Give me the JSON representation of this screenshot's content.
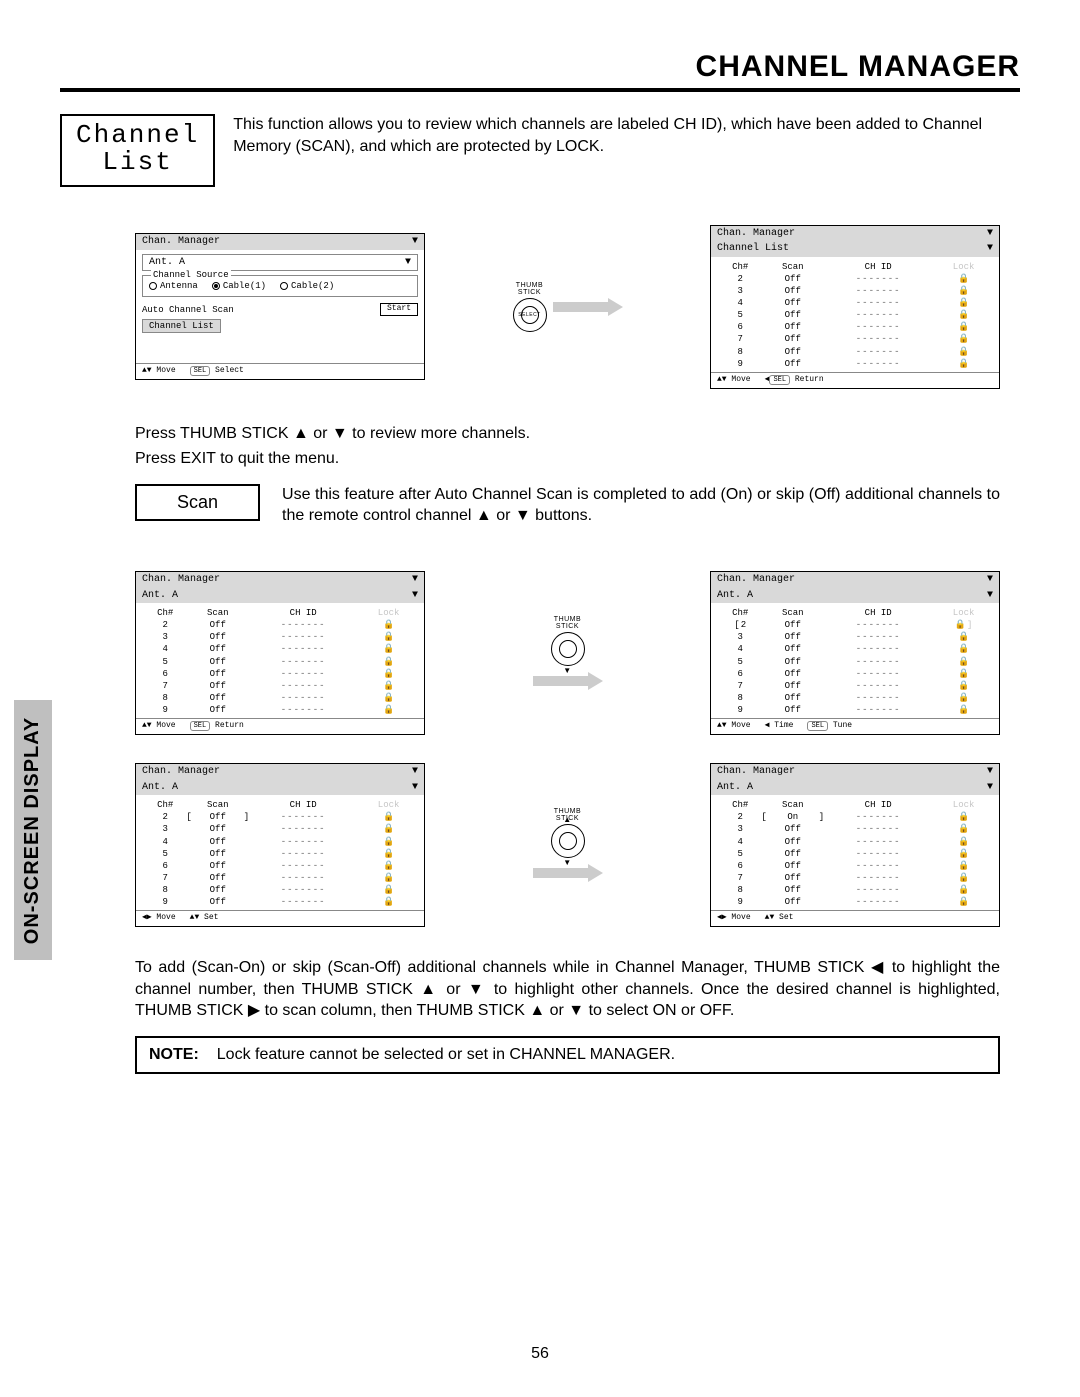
{
  "header": {
    "title": "CHANNEL MANAGER"
  },
  "boxTitle": {
    "line1": "Channel",
    "line2": "List"
  },
  "intro": "This function allows you to review which channels are labeled CH ID), which have been added to Channel Memory (SCAN), and which are protected by LOCK.",
  "sidebar": {
    "label": "ON-SCREEN DISPLAY"
  },
  "thumb": {
    "label1": "THUMB",
    "label2": "STICK",
    "select": "SELECT"
  },
  "panelA": {
    "bar": "Chan. Manager",
    "ant": "Ant. A",
    "sourceLegend": "Channel Source",
    "r1": "Antenna",
    "r2": "Cable(1)",
    "r3": "Cable(2)",
    "autoScan": "Auto Channel Scan",
    "start": "Start",
    "chList": "Channel List",
    "footMove": "Move",
    "footSel": "Select",
    "sel": "SEL",
    "ud": "▲▼"
  },
  "panelB": {
    "bar": "Chan. Manager",
    "sub": "Channel List",
    "headers": {
      "ch": "Ch#",
      "scan": "Scan",
      "chid": "CH ID",
      "lock": "Lock"
    },
    "rows": [
      {
        "ch": "2",
        "scan": "Off",
        "chid": "-------",
        "lock": "🔒"
      },
      {
        "ch": "3",
        "scan": "Off",
        "chid": "-------",
        "lock": "🔒"
      },
      {
        "ch": "4",
        "scan": "Off",
        "chid": "-------",
        "lock": "🔒"
      },
      {
        "ch": "5",
        "scan": "Off",
        "chid": "-------",
        "lock": "🔒"
      },
      {
        "ch": "6",
        "scan": "Off",
        "chid": "-------",
        "lock": "🔒"
      },
      {
        "ch": "7",
        "scan": "Off",
        "chid": "-------",
        "lock": "🔒"
      },
      {
        "ch": "8",
        "scan": "Off",
        "chid": "-------",
        "lock": "🔒"
      },
      {
        "ch": "9",
        "scan": "Off",
        "chid": "-------",
        "lock": "🔒"
      }
    ],
    "footMove": "Move",
    "footRet": "Return",
    "ud": "▲▼",
    "lt": "◀",
    "sel": "SEL"
  },
  "review": {
    "line1": "Press THUMB STICK ▲ or ▼ to review more channels.",
    "line2": "Press EXIT to quit the menu."
  },
  "scanBox": "Scan",
  "scanPara": "Use this feature after Auto Channel Scan is completed to add (On) or skip (Off) additional channels to the remote control channel ▲ or ▼ buttons.",
  "panelC": {
    "bar": "Chan. Manager",
    "ant": "Ant. A",
    "headers": {
      "ch": "Ch#",
      "scan": "Scan",
      "chid": "CH ID",
      "lock": "Lock"
    },
    "rows": [
      {
        "ch": "2",
        "scan": "Off",
        "chid": "-------",
        "lock": "🔒"
      },
      {
        "ch": "3",
        "scan": "Off",
        "chid": "-------",
        "lock": "🔒"
      },
      {
        "ch": "4",
        "scan": "Off",
        "chid": "-------",
        "lock": "🔒"
      },
      {
        "ch": "5",
        "scan": "Off",
        "chid": "-------",
        "lock": "🔒"
      },
      {
        "ch": "6",
        "scan": "Off",
        "chid": "-------",
        "lock": "🔒"
      },
      {
        "ch": "7",
        "scan": "Off",
        "chid": "-------",
        "lock": "🔒"
      },
      {
        "ch": "8",
        "scan": "Off",
        "chid": "-------",
        "lock": "🔒"
      },
      {
        "ch": "9",
        "scan": "Off",
        "chid": "-------",
        "lock": "🔒"
      }
    ],
    "footMove": "Move",
    "footRet": "Return",
    "ud": "▲▼",
    "sel": "SEL"
  },
  "panelD": {
    "bar": "Chan. Manager",
    "ant": "Ant. A",
    "headers": {
      "ch": "Ch#",
      "scan": "Scan",
      "chid": "CH ID",
      "lock": "Lock"
    },
    "rows": [
      {
        "ch": "2",
        "scan": "Off",
        "chid": "-------",
        "lock": "🔒",
        "sel": true
      },
      {
        "ch": "3",
        "scan": "Off",
        "chid": "-------",
        "lock": "🔒"
      },
      {
        "ch": "4",
        "scan": "Off",
        "chid": "-------",
        "lock": "🔒"
      },
      {
        "ch": "5",
        "scan": "Off",
        "chid": "-------",
        "lock": "🔒"
      },
      {
        "ch": "6",
        "scan": "Off",
        "chid": "-------",
        "lock": "🔒"
      },
      {
        "ch": "7",
        "scan": "Off",
        "chid": "-------",
        "lock": "🔒"
      },
      {
        "ch": "8",
        "scan": "Off",
        "chid": "-------",
        "lock": "🔒"
      },
      {
        "ch": "9",
        "scan": "Off",
        "chid": "-------",
        "lock": "🔒"
      }
    ],
    "footMove": "Move",
    "footTime": "Time",
    "footTune": "Tune",
    "ud": "▲▼",
    "lt": "◀",
    "sel": "SEL"
  },
  "panelE": {
    "bar": "Chan. Manager",
    "ant": "Ant. A",
    "headers": {
      "ch": "Ch#",
      "scan": "Scan",
      "chid": "CH ID",
      "lock": "Lock"
    },
    "rows": [
      {
        "ch": "2",
        "scan": "Off",
        "chid": "-------",
        "lock": "🔒",
        "selScan": true
      },
      {
        "ch": "3",
        "scan": "Off",
        "chid": "-------",
        "lock": "🔒"
      },
      {
        "ch": "4",
        "scan": "Off",
        "chid": "-------",
        "lock": "🔒"
      },
      {
        "ch": "5",
        "scan": "Off",
        "chid": "-------",
        "lock": "🔒"
      },
      {
        "ch": "6",
        "scan": "Off",
        "chid": "-------",
        "lock": "🔒"
      },
      {
        "ch": "7",
        "scan": "Off",
        "chid": "-------",
        "lock": "🔒"
      },
      {
        "ch": "8",
        "scan": "Off",
        "chid": "-------",
        "lock": "🔒"
      },
      {
        "ch": "9",
        "scan": "Off",
        "chid": "-------",
        "lock": "🔒"
      }
    ],
    "footMove": "Move",
    "footSet": "Set",
    "lr": "◀▶",
    "ud": "▲▼"
  },
  "panelF": {
    "bar": "Chan. Manager",
    "ant": "Ant. A",
    "headers": {
      "ch": "Ch#",
      "scan": "Scan",
      "chid": "CH ID",
      "lock": "Lock"
    },
    "rows": [
      {
        "ch": "2",
        "scan": "On",
        "chid": "-------",
        "lock": "🔒",
        "selScan": true
      },
      {
        "ch": "3",
        "scan": "Off",
        "chid": "-------",
        "lock": "🔒"
      },
      {
        "ch": "4",
        "scan": "Off",
        "chid": "-------",
        "lock": "🔒"
      },
      {
        "ch": "5",
        "scan": "Off",
        "chid": "-------",
        "lock": "🔒"
      },
      {
        "ch": "6",
        "scan": "Off",
        "chid": "-------",
        "lock": "🔒"
      },
      {
        "ch": "7",
        "scan": "Off",
        "chid": "-------",
        "lock": "🔒"
      },
      {
        "ch": "8",
        "scan": "Off",
        "chid": "-------",
        "lock": "🔒"
      },
      {
        "ch": "9",
        "scan": "Off",
        "chid": "-------",
        "lock": "🔒"
      }
    ],
    "footMove": "Move",
    "footSet": "Set",
    "lr": "◀▶",
    "ud": "▲▼"
  },
  "scanInstr": "To add (Scan-On) or skip (Scan-Off) additional channels while in Channel Manager, THUMB STICK ◀ to highlight the channel number, then THUMB STICK ▲ or ▼ to highlight other channels.  Once the desired channel is highlighted, THUMB STICK ▶ to scan column, then THUMB STICK ▲ or ▼ to select ON or OFF.",
  "note": {
    "label": "NOTE:",
    "text": "Lock feature cannot be selected or set in CHANNEL MANAGER."
  },
  "pageNum": "56"
}
